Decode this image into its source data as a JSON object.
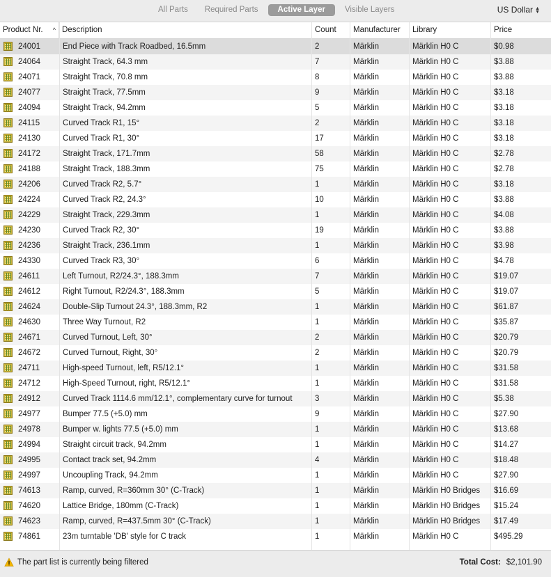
{
  "toolbar": {
    "tabs": [
      {
        "label": "All Parts",
        "active": false
      },
      {
        "label": "Required Parts",
        "active": false
      },
      {
        "label": "Active Layer",
        "active": true
      },
      {
        "label": "Visible Layers",
        "active": false
      }
    ],
    "currency": "US Dollar"
  },
  "table": {
    "columns": [
      "Product Nr.",
      "Description",
      "Count",
      "Manufacturer",
      "Library",
      "Price"
    ],
    "sort_column": "Product Nr.",
    "sort_direction": "ascending",
    "row_icon": "track-part-icon",
    "rows": [
      {
        "nr": "24001",
        "desc": "End Piece with Track Roadbed, 16.5mm",
        "count": "2",
        "mfr": "Märklin",
        "lib": "Märklin H0 C",
        "price": "$0.98"
      },
      {
        "nr": "24064",
        "desc": "Straight Track, 64.3 mm",
        "count": "7",
        "mfr": "Märklin",
        "lib": "Märklin H0 C",
        "price": "$3.88"
      },
      {
        "nr": "24071",
        "desc": "Straight Track, 70.8 mm",
        "count": "8",
        "mfr": "Märklin",
        "lib": "Märklin H0 C",
        "price": "$3.88"
      },
      {
        "nr": "24077",
        "desc": "Straight Track, 77.5mm",
        "count": "9",
        "mfr": "Märklin",
        "lib": "Märklin H0 C",
        "price": "$3.18"
      },
      {
        "nr": "24094",
        "desc": "Straight Track, 94.2mm",
        "count": "5",
        "mfr": "Märklin",
        "lib": "Märklin H0 C",
        "price": "$3.18"
      },
      {
        "nr": "24115",
        "desc": "Curved Track R1, 15°",
        "count": "2",
        "mfr": "Märklin",
        "lib": "Märklin H0 C",
        "price": "$3.18"
      },
      {
        "nr": "24130",
        "desc": "Curved Track R1, 30°",
        "count": "17",
        "mfr": "Märklin",
        "lib": "Märklin H0 C",
        "price": "$3.18"
      },
      {
        "nr": "24172",
        "desc": "Straight Track, 171.7mm",
        "count": "58",
        "mfr": "Märklin",
        "lib": "Märklin H0 C",
        "price": "$2.78"
      },
      {
        "nr": "24188",
        "desc": "Straight Track, 188.3mm",
        "count": "75",
        "mfr": "Märklin",
        "lib": "Märklin H0 C",
        "price": "$2.78"
      },
      {
        "nr": "24206",
        "desc": "Curved Track R2, 5.7°",
        "count": "1",
        "mfr": "Märklin",
        "lib": "Märklin H0 C",
        "price": "$3.18"
      },
      {
        "nr": "24224",
        "desc": "Curved Track R2, 24.3°",
        "count": "10",
        "mfr": "Märklin",
        "lib": "Märklin H0 C",
        "price": "$3.88"
      },
      {
        "nr": "24229",
        "desc": "Straight Track, 229.3mm",
        "count": "1",
        "mfr": "Märklin",
        "lib": "Märklin H0 C",
        "price": "$4.08"
      },
      {
        "nr": "24230",
        "desc": "Curved Track R2, 30°",
        "count": "19",
        "mfr": "Märklin",
        "lib": "Märklin H0 C",
        "price": "$3.88"
      },
      {
        "nr": "24236",
        "desc": "Straight Track, 236.1mm",
        "count": "1",
        "mfr": "Märklin",
        "lib": "Märklin H0 C",
        "price": "$3.98"
      },
      {
        "nr": "24330",
        "desc": "Curved Track R3, 30°",
        "count": "6",
        "mfr": "Märklin",
        "lib": "Märklin H0 C",
        "price": "$4.78"
      },
      {
        "nr": "24611",
        "desc": "Left Turnout, R2/24.3°, 188.3mm",
        "count": "7",
        "mfr": "Märklin",
        "lib": "Märklin H0 C",
        "price": "$19.07"
      },
      {
        "nr": "24612",
        "desc": "Right Turnout, R2/24.3°, 188.3mm",
        "count": "5",
        "mfr": "Märklin",
        "lib": "Märklin H0 C",
        "price": "$19.07"
      },
      {
        "nr": "24624",
        "desc": "Double-Slip Turnout 24.3°, 188.3mm, R2",
        "count": "1",
        "mfr": "Märklin",
        "lib": "Märklin H0 C",
        "price": "$61.87"
      },
      {
        "nr": "24630",
        "desc": "Three Way Turnout, R2",
        "count": "1",
        "mfr": "Märklin",
        "lib": "Märklin H0 C",
        "price": "$35.87"
      },
      {
        "nr": "24671",
        "desc": "Curved Turnout, Left, 30°",
        "count": "2",
        "mfr": "Märklin",
        "lib": "Märklin H0 C",
        "price": "$20.79"
      },
      {
        "nr": "24672",
        "desc": "Curved Turnout, Right, 30°",
        "count": "2",
        "mfr": "Märklin",
        "lib": "Märklin H0 C",
        "price": "$20.79"
      },
      {
        "nr": "24711",
        "desc": "High-speed Turnout, left, R5/12.1°",
        "count": "1",
        "mfr": "Märklin",
        "lib": "Märklin H0 C",
        "price": "$31.58"
      },
      {
        "nr": "24712",
        "desc": "High-Speed Turnout, right, R5/12.1°",
        "count": "1",
        "mfr": "Märklin",
        "lib": "Märklin H0 C",
        "price": "$31.58"
      },
      {
        "nr": "24912",
        "desc": "Curved Track 1114.6 mm/12.1°, complementary curve for turnout",
        "count": "3",
        "mfr": "Märklin",
        "lib": "Märklin H0 C",
        "price": "$5.38"
      },
      {
        "nr": "24977",
        "desc": "Bumper 77.5 (+5.0) mm",
        "count": "9",
        "mfr": "Märklin",
        "lib": "Märklin H0 C",
        "price": "$27.90"
      },
      {
        "nr": "24978",
        "desc": "Bumper w. lights 77.5 (+5.0) mm",
        "count": "1",
        "mfr": "Märklin",
        "lib": "Märklin H0 C",
        "price": "$13.68"
      },
      {
        "nr": "24994",
        "desc": "Straight circuit track, 94.2mm",
        "count": "1",
        "mfr": "Märklin",
        "lib": "Märklin H0 C",
        "price": "$14.27"
      },
      {
        "nr": "24995",
        "desc": "Contact track set, 94.2mm",
        "count": "4",
        "mfr": "Märklin",
        "lib": "Märklin H0 C",
        "price": "$18.48"
      },
      {
        "nr": "24997",
        "desc": "Uncoupling Track, 94.2mm",
        "count": "1",
        "mfr": "Märklin",
        "lib": "Märklin H0 C",
        "price": "$27.90"
      },
      {
        "nr": "74613",
        "desc": "Ramp, curved, R=360mm 30° (C-Track)",
        "count": "1",
        "mfr": "Märklin",
        "lib": "Märklin H0 Bridges",
        "price": "$16.69"
      },
      {
        "nr": "74620",
        "desc": "Lattice Bridge, 180mm (C-Track)",
        "count": "1",
        "mfr": "Märklin",
        "lib": "Märklin H0 Bridges",
        "price": "$15.24"
      },
      {
        "nr": "74623",
        "desc": "Ramp, curved, R=437.5mm 30° (C-Track)",
        "count": "1",
        "mfr": "Märklin",
        "lib": "Märklin H0 Bridges",
        "price": "$17.49"
      },
      {
        "nr": "74861",
        "desc": "23m turntable 'DB' style for C track",
        "count": "1",
        "mfr": "Märklin",
        "lib": "Märklin H0 C",
        "price": "$495.29"
      }
    ]
  },
  "status": {
    "icon": "warning-icon",
    "message": "The part list is currently being filtered",
    "total_label": "Total Cost:",
    "total_value": "$2,101.90"
  },
  "colors": {
    "active_tab_bg": "#9b9b9b",
    "row_alt_bg": "#f4f4f4",
    "selected_row_bg": "#dcdcdc",
    "warning": "#f2b500"
  }
}
